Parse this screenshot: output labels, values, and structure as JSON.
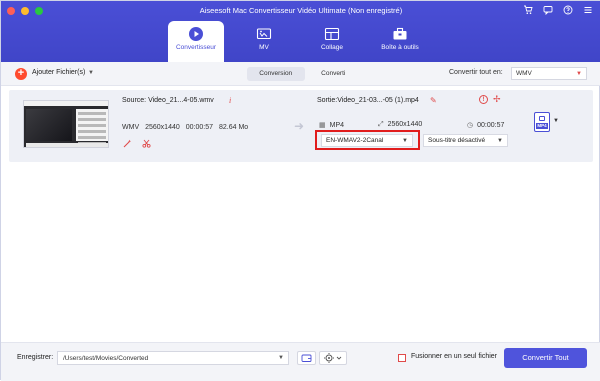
{
  "window": {
    "title": "Aiseesoft Mac Convertisseur Vidéo Ultimate (Non enregistré)"
  },
  "header_icons": [
    "cart-icon",
    "chat-icon",
    "help-icon",
    "menu-icon"
  ],
  "tabs": [
    {
      "label": "Convertisseur",
      "icon": "convert-icon",
      "active": true
    },
    {
      "label": "MV",
      "icon": "mv-icon",
      "active": false
    },
    {
      "label": "Collage",
      "icon": "collage-icon",
      "active": false
    },
    {
      "label": "Boîte à outils",
      "icon": "toolbox-icon",
      "active": false
    }
  ],
  "toolbar": {
    "add_files_label": "Ajouter Fichier(s)",
    "segments": [
      "Conversion",
      "Converti"
    ],
    "convert_all_label": "Convertir tout en:",
    "convert_all_value": "WMV"
  },
  "file": {
    "source_label": "Source: Video_21...4-05.wmv",
    "format": "WMV",
    "resolution": "2560x1440",
    "duration": "00:00:57",
    "size": "82.64 Mo",
    "output_label": "Sortie:Video_21-03...-05 (1).mp4",
    "output_format": "MP4",
    "output_resolution": "2560x1440",
    "output_duration": "00:00:57",
    "audio_track": "EN-WMAV2-2Canal",
    "subtitle": "Sous-titre désactivé",
    "format_badge": "MP4"
  },
  "footer": {
    "save_label": "Enregistrer:",
    "save_path": "/Users/test/Movies/Converted",
    "merge_label": "Fusionner en un seul fichier",
    "convert_all_button": "Convertir Tout"
  },
  "colors": {
    "accent": "#4a4fd6",
    "red": "#e04a4a",
    "highlight": "#e11d1d"
  }
}
